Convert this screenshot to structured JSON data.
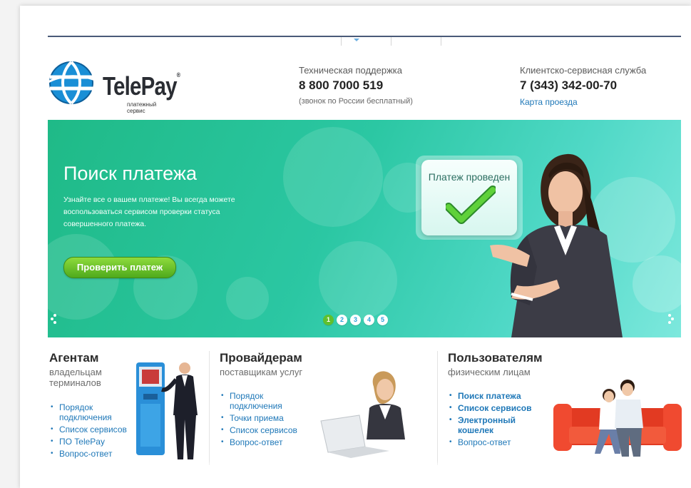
{
  "brand": {
    "name": "TelePay",
    "reg": "®",
    "tagline": "платежный сервис"
  },
  "support": {
    "label": "Техническая поддержка",
    "phone": "8 800 7000 519",
    "note": "(звонок по России бесплатный)"
  },
  "service": {
    "label": "Клиентско-сервисная служба",
    "phone": "7 (343) 342-00-70",
    "link": "Карта проезда"
  },
  "banner": {
    "title": "Поиск платежа",
    "description": "Узнайте все о вашем платеже! Вы всегда можете воспользоваться сервисом проверки статуса совершенного платежа.",
    "button": "Проверить платеж",
    "status_card": "Платеж проведен",
    "slides": [
      "1",
      "2",
      "3",
      "4",
      "5"
    ],
    "active_slide": 0
  },
  "columns": {
    "agents": {
      "title": "Агентам",
      "subtitle": "владельцам терминалов",
      "links": [
        "Порядок подключения",
        "Список сервисов",
        "ПО TelePay",
        "Вопрос-ответ"
      ]
    },
    "providers": {
      "title": "Провайдерам",
      "subtitle": "поставщикам услуг",
      "links": [
        "Порядок подключения",
        "Точки приема",
        "Список сервисов",
        "Вопрос-ответ"
      ]
    },
    "users": {
      "title": "Пользователям",
      "subtitle": "физическим лицам",
      "links": [
        "Поиск платежа",
        "Список сервисов",
        "Электронный кошелек",
        "Вопрос-ответ"
      ]
    }
  },
  "colors": {
    "accent_blue": "#1f78b8",
    "banner_green": "#1fba87",
    "button_green": "#5fc02d",
    "dark_text": "#2b2b2b"
  }
}
